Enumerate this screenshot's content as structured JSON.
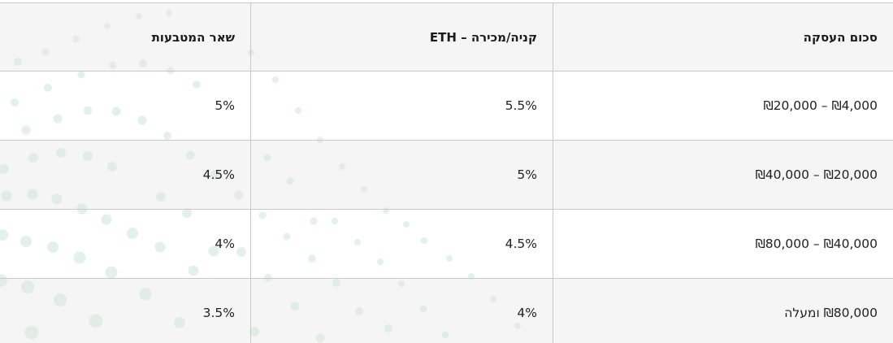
{
  "fee_table": {
    "headers": {
      "amount": "סכום העסקה",
      "eth": "קניה/מכירה – ETH",
      "other": "שאר המטבעות"
    },
    "rows": [
      {
        "amount": "₪4,000 – ₪20,000",
        "eth": "5.5%",
        "other": "5%"
      },
      {
        "amount": "₪20,000 – ₪40,000",
        "eth": "5%",
        "other": "4.5%"
      },
      {
        "amount": "₪40,000 – ₪80,000",
        "eth": "4.5%",
        "other": "4%"
      },
      {
        "amount": "₪80,000 ומעלה",
        "eth": "4%",
        "other": "3.5%"
      }
    ]
  },
  "colors": {
    "border": "#c9c9c9",
    "row_shade": "#ececec",
    "dot": "#d6eadf"
  }
}
